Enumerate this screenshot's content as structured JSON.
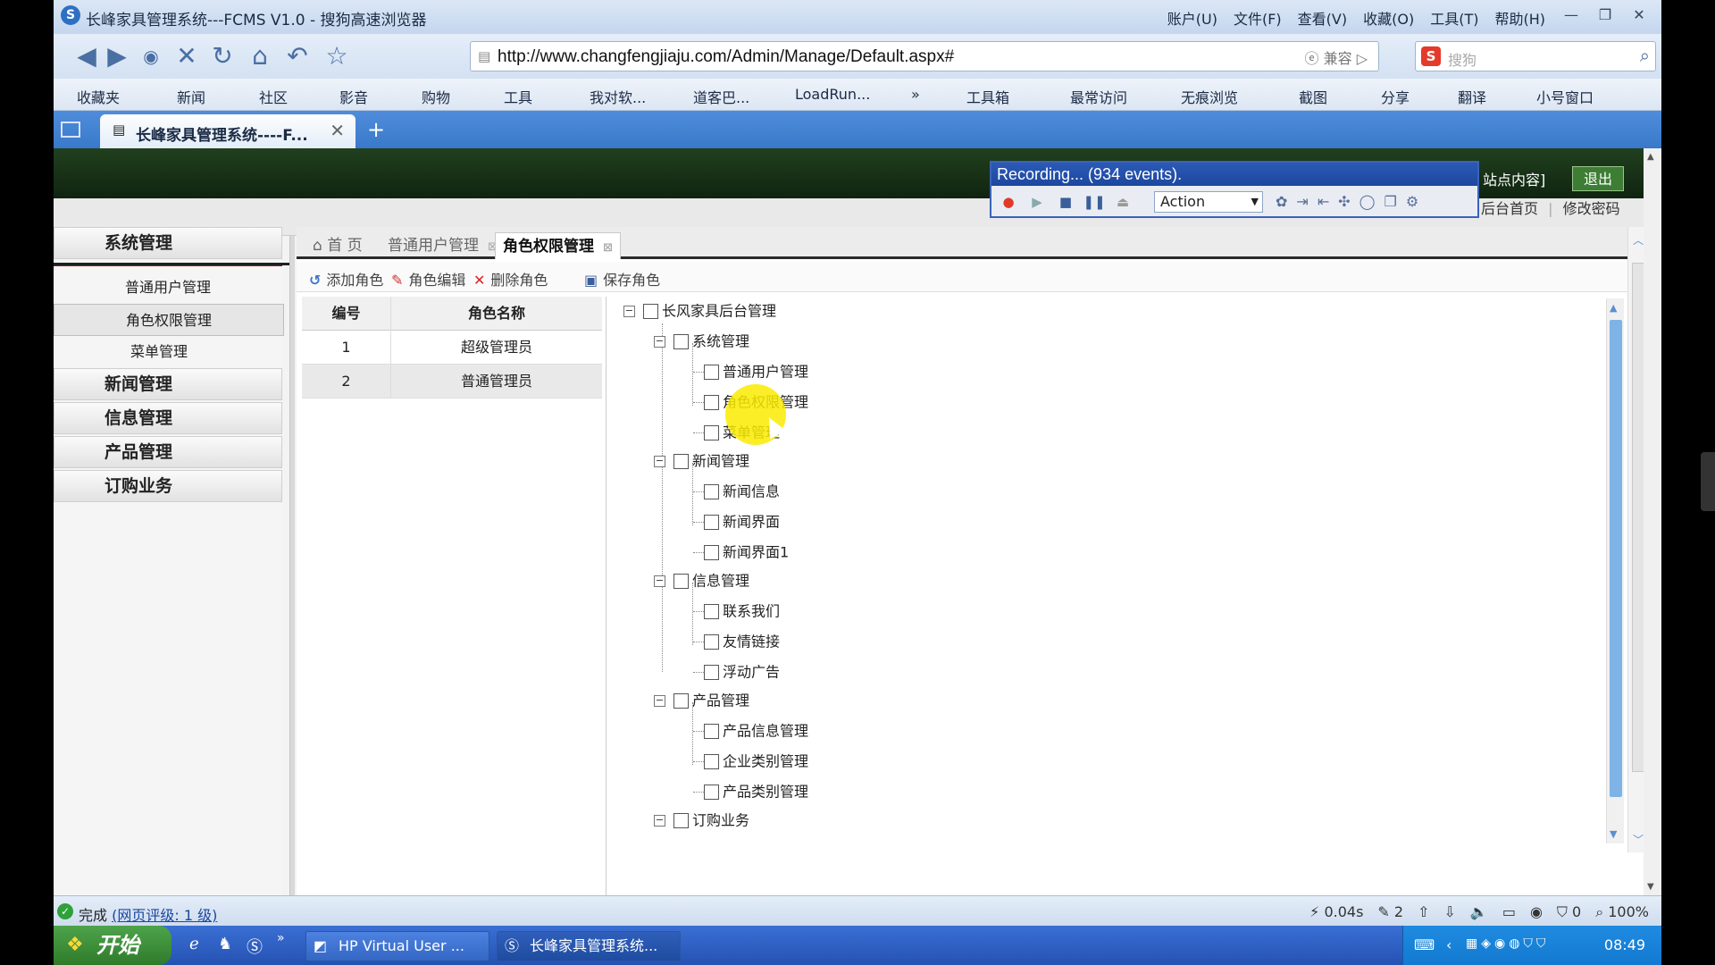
{
  "browser": {
    "title": "长峰家具管理系统---FCMS V1.0 - 搜狗高速浏览器",
    "menus": [
      "账户(U)",
      "文件(F)",
      "查看(V)",
      "收藏(O)",
      "工具(T)",
      "帮助(H)"
    ],
    "url": "http://www.changfengjiaju.com/Admin/Manage/Default.aspx#",
    "compat": "兼容",
    "search_placeholder": "搜狗",
    "favorites": [
      "收藏夹",
      "新闻",
      "社区",
      "影音",
      "购物",
      "工具",
      "我对软...",
      "道客巴...",
      "LoadRun...",
      "»",
      "工具箱",
      "最常访问",
      "无痕浏览",
      "截图",
      "分享",
      "翻译",
      "小号窗口"
    ],
    "tab_title": "长峰家具管理系统----F..."
  },
  "header": {
    "site_content": "站点内容]",
    "exit": "退出",
    "home_link": "后台首页",
    "change_pwd": "修改密码"
  },
  "sidebar": {
    "groups": [
      "系统管理",
      "新闻管理",
      "信息管理",
      "产品管理",
      "订购业务"
    ],
    "items": [
      "普通用户管理",
      "角色权限管理",
      "菜单管理"
    ]
  },
  "page_tabs": [
    "首 页",
    "普通用户管理",
    "角色权限管理"
  ],
  "toolbar": {
    "add_role": "添加角色",
    "edit_role": "角色编辑",
    "delete_role": "删除角色",
    "save_role": "保存角色"
  },
  "role_table": {
    "headers": [
      "编号",
      "角色名称"
    ],
    "rows": [
      {
        "id": "1",
        "name": "超级管理员"
      },
      {
        "id": "2",
        "name": "普通管理员"
      }
    ]
  },
  "tree": {
    "root": "长风家具后台管理",
    "groups": [
      {
        "label": "系统管理",
        "children": [
          "普通用户管理",
          "角色权限管理",
          "菜单管理"
        ]
      },
      {
        "label": "新闻管理",
        "children": [
          "新闻信息",
          "新闻界面",
          "新闻界面1"
        ]
      },
      {
        "label": "信息管理",
        "children": [
          "联系我们",
          "友情链接",
          "浮动广告"
        ]
      },
      {
        "label": "产品管理",
        "children": [
          "产品信息管理",
          "企业类别管理",
          "产品类别管理"
        ]
      },
      {
        "label": "订购业务",
        "children": []
      }
    ]
  },
  "recorder": {
    "title": "Recording... (934 events).",
    "mode": "Action"
  },
  "status": {
    "text": "完成",
    "rating": "(网页评级: 1 级)",
    "time": "0.04s",
    "count": "2",
    "shield": "0",
    "zoom": "100%"
  },
  "taskbar": {
    "start": "开始",
    "tasks": [
      "HP Virtual User ...",
      "长峰家具管理系统..."
    ],
    "clock": "08:49"
  },
  "colors": {
    "header_green": "#1a3518",
    "exit_green": "#3e7d34",
    "tab_blue": "#3a78c9",
    "highlight_yellow": "#faeb00"
  }
}
